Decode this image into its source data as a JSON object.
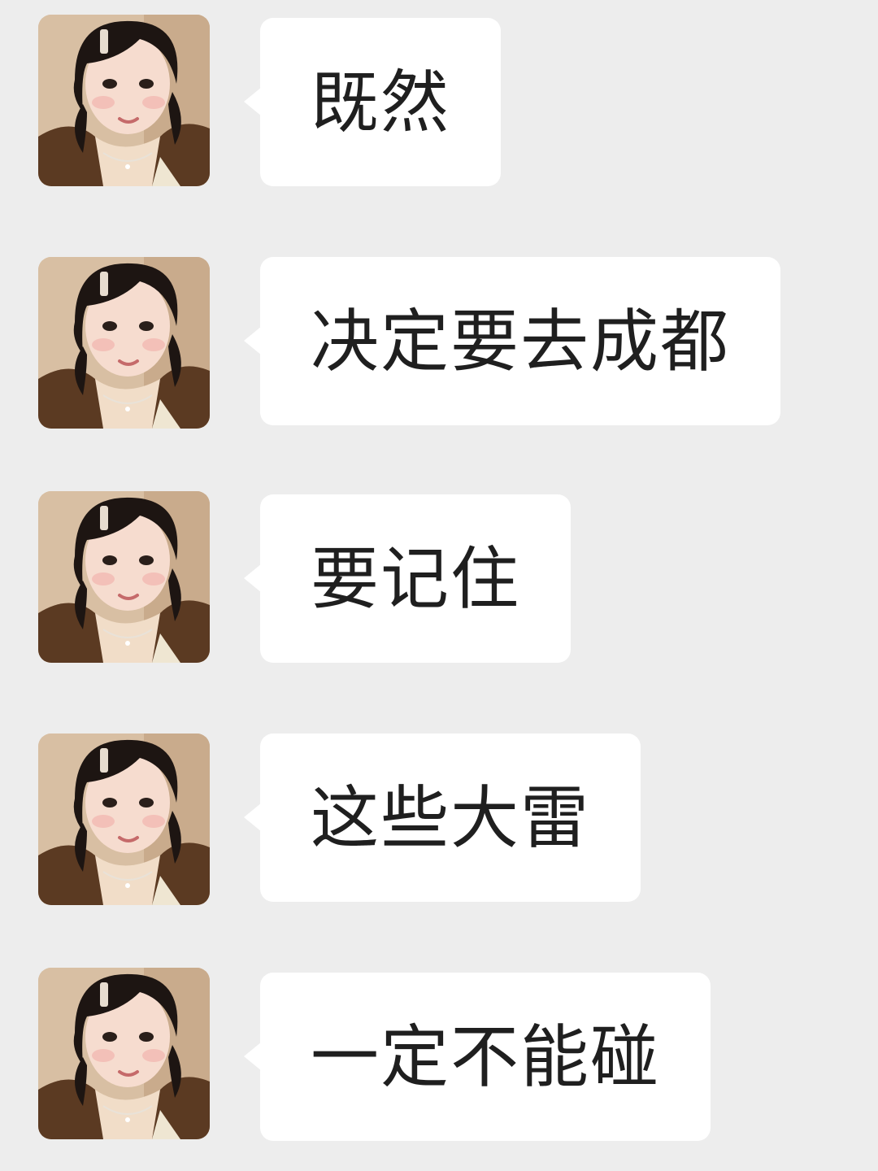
{
  "colors": {
    "background": "#ededed",
    "bubble": "#ffffff",
    "text": "#1f1f1f"
  },
  "messages": [
    {
      "text": "既然",
      "avatar": "avatar-photo"
    },
    {
      "text": "决定要去成都",
      "avatar": "avatar-photo"
    },
    {
      "text": "要记住",
      "avatar": "avatar-photo"
    },
    {
      "text": "这些大雷",
      "avatar": "avatar-photo"
    },
    {
      "text": "一定不能碰",
      "avatar": "avatar-photo"
    }
  ]
}
